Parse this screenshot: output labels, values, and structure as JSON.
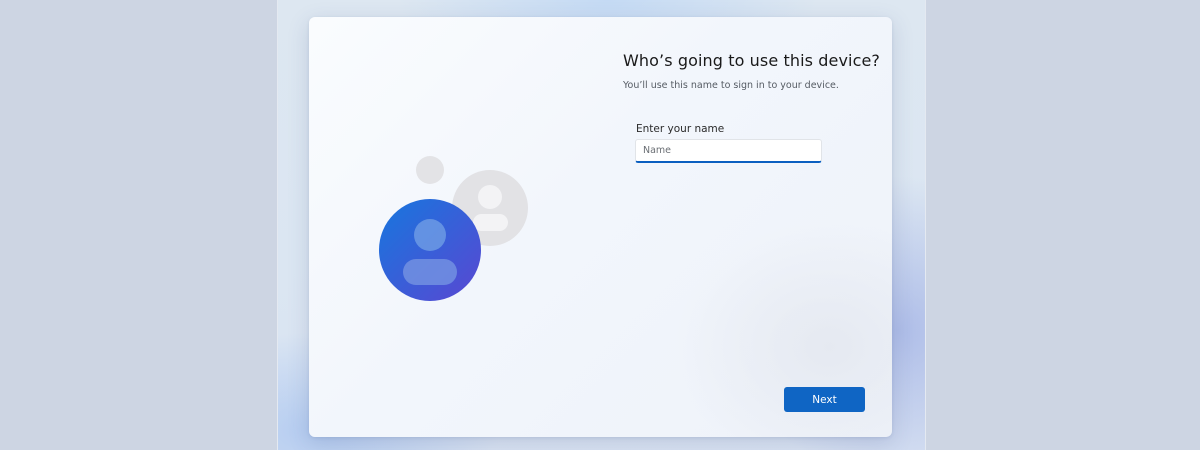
{
  "setup": {
    "title": "Who’s going to use this device?",
    "subtitle": "You’ll use this name to sign in to your device.",
    "name_field": {
      "label": "Enter your name",
      "placeholder": "Name",
      "value": ""
    },
    "next_label": "Next"
  },
  "illustration": {
    "icon": "user-accounts-icon",
    "primary_color": "#1a6fd6",
    "secondary_color": "#5b48d4",
    "inactive_color": "#e2e2e5"
  },
  "colors": {
    "accent": "#0f65c4",
    "page_background": "#cdd5e3"
  }
}
